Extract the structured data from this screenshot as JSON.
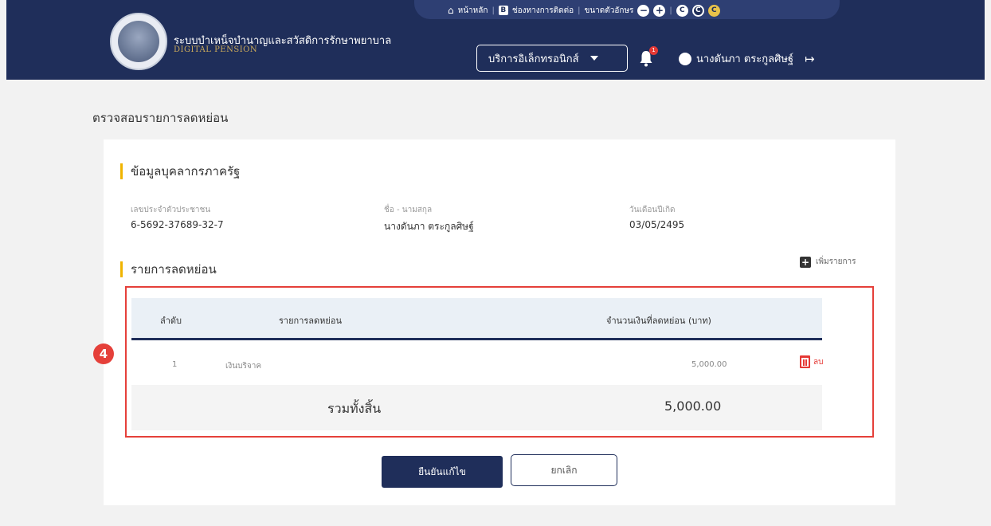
{
  "header": {
    "system_title": "ระบบบำเหน็จบำนาญและสวัสดิการรักษาพยาบาล",
    "system_subtitle": "DIGITAL PENSION",
    "top_links": {
      "home": "หน้าหลัก",
      "guide": "ช่องทางการติดต่อ",
      "font_size": "ขนาดตัวอักษร",
      "minus": "−",
      "plus": "+",
      "contrast": [
        "C",
        "C",
        "C"
      ]
    },
    "service_select": "บริการอิเล็กทรอนิกส์",
    "notification_count": "1",
    "user_name": "นางดันภา ตระกูลศิษฐ์",
    "logout_icon": "↦"
  },
  "page": {
    "title": "ตรวจสอบรายการลดหย่อน"
  },
  "person_section": {
    "title": "ข้อมูลบุคลากรภาครัฐ",
    "fields": [
      {
        "label": "เลขประจำตัวประชาชน",
        "value": "6-5692-37689-32-7"
      },
      {
        "label": "ชื่อ - นามสกุล",
        "value": "นางดันภา ตระกูลศิษฐ์"
      },
      {
        "label": "วันเดือนปีเกิด",
        "value": "03/05/2495"
      }
    ]
  },
  "deduction_section": {
    "title": "รายการลดหย่อน",
    "add_label": "เพิ่มรายการ",
    "step_number": "4",
    "table": {
      "headers": [
        "ลำดับ",
        "รายการลดหย่อน",
        "จำนวนเงินที่ลดหย่อน (บาท)"
      ],
      "rows": [
        {
          "no": "1",
          "item": "เงินบริจาค",
          "amount": "5,000.00",
          "delete_label": "ลบ"
        }
      ],
      "total_label": "รวมทั้งสิ้น",
      "total_value": "5,000.00"
    }
  },
  "actions": {
    "confirm_label": "ยืนยันแก้ไข",
    "cancel_label": "ยกเลิก"
  },
  "colors": {
    "header_bg": "#1f2e5a",
    "accent_bar": "#f0b400",
    "highlight": "#e5403a",
    "delete": "#e53935"
  }
}
